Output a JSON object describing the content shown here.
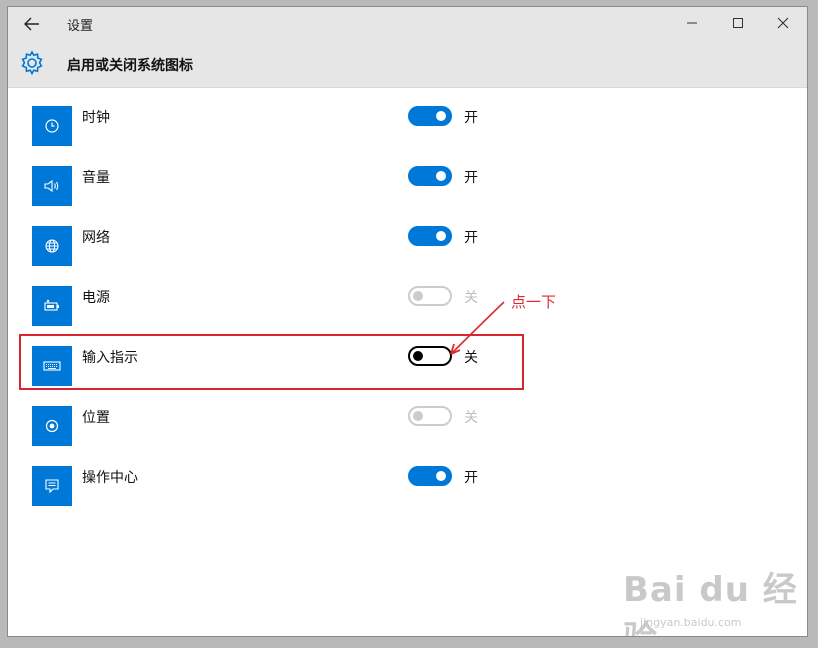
{
  "window": {
    "app_title": "设置",
    "back_icon": "arrow-left-icon",
    "controls": [
      "minimize-icon",
      "maximize-icon",
      "close-icon"
    ]
  },
  "header": {
    "icon": "gear-icon",
    "title": "启用或关闭系统图标"
  },
  "items": [
    {
      "label": "时钟",
      "icon": "clock-icon",
      "state": "on",
      "state_label": "开"
    },
    {
      "label": "音量",
      "icon": "volume-icon",
      "state": "on",
      "state_label": "开"
    },
    {
      "label": "网络",
      "icon": "globe-icon",
      "state": "on",
      "state_label": "开"
    },
    {
      "label": "电源",
      "icon": "battery-icon",
      "state": "disabled",
      "state_label": "关"
    },
    {
      "label": "输入指示",
      "icon": "keyboard-icon",
      "state": "off",
      "state_label": "关"
    },
    {
      "label": "位置",
      "icon": "location-icon",
      "state": "disabled",
      "state_label": "关"
    },
    {
      "label": "操作中心",
      "icon": "action-center-icon",
      "state": "on",
      "state_label": "开"
    }
  ],
  "annotation": {
    "text": "点一下",
    "color": "#e0282f"
  },
  "watermark": {
    "main": "Bai du 经验",
    "sub": "jingyan.baidu.com"
  },
  "colors": {
    "accent": "#0078d7",
    "titlebar": "#e6e6e6",
    "highlight": "#d9252d"
  }
}
